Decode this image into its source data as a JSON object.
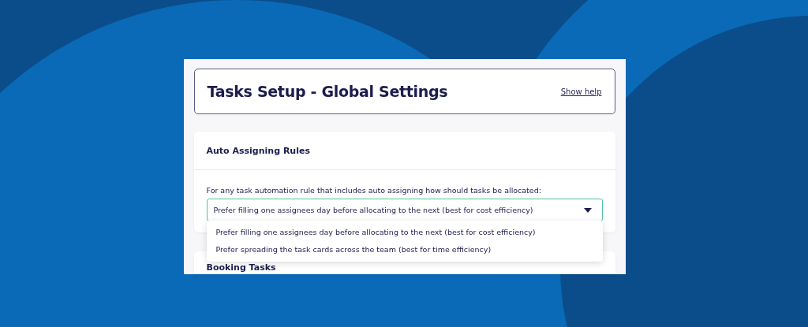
{
  "header": {
    "title": "Tasks Setup - Global Settings",
    "help_link": "Show help"
  },
  "auto_assigning": {
    "title": "Auto Assigning Rules",
    "question": "For any task automation rule that includes auto assigning how should tasks be allocated:",
    "select": {
      "value": "Prefer filling one assignees day before allocating to the next (best for cost efficiency)",
      "focused": true
    },
    "menu": [
      {
        "label": "Prefer filling one assignees day before allocating to the next (best for cost efficiency)"
      },
      {
        "label": "Prefer spreading the task cards across the team (best for time efficiency)"
      }
    ]
  },
  "booking_tasks": {
    "title": "Booking Tasks"
  }
}
